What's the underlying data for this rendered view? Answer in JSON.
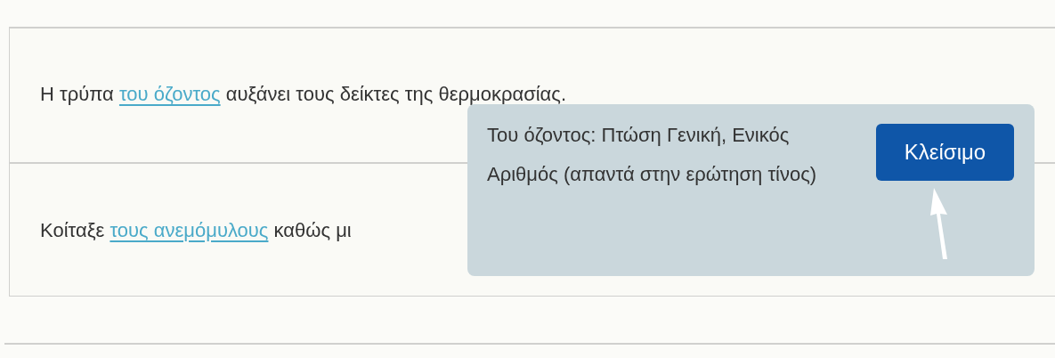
{
  "sentences": [
    {
      "before": "Η τρύπα ",
      "link": "του όζοντος",
      "after": " αυξάνει τους δείκτες της θερμοκρασίας."
    },
    {
      "before": "Κοίταξε ",
      "link": "τους ανεμόμυλους",
      "after": " καθώς μι"
    }
  ],
  "popover": {
    "text": "Του όζοντος: Πτώση Γενική, Ενικός Αριθμός (απαντά στην ερώτηση τίνος)",
    "button": "Κλείσιμο"
  }
}
